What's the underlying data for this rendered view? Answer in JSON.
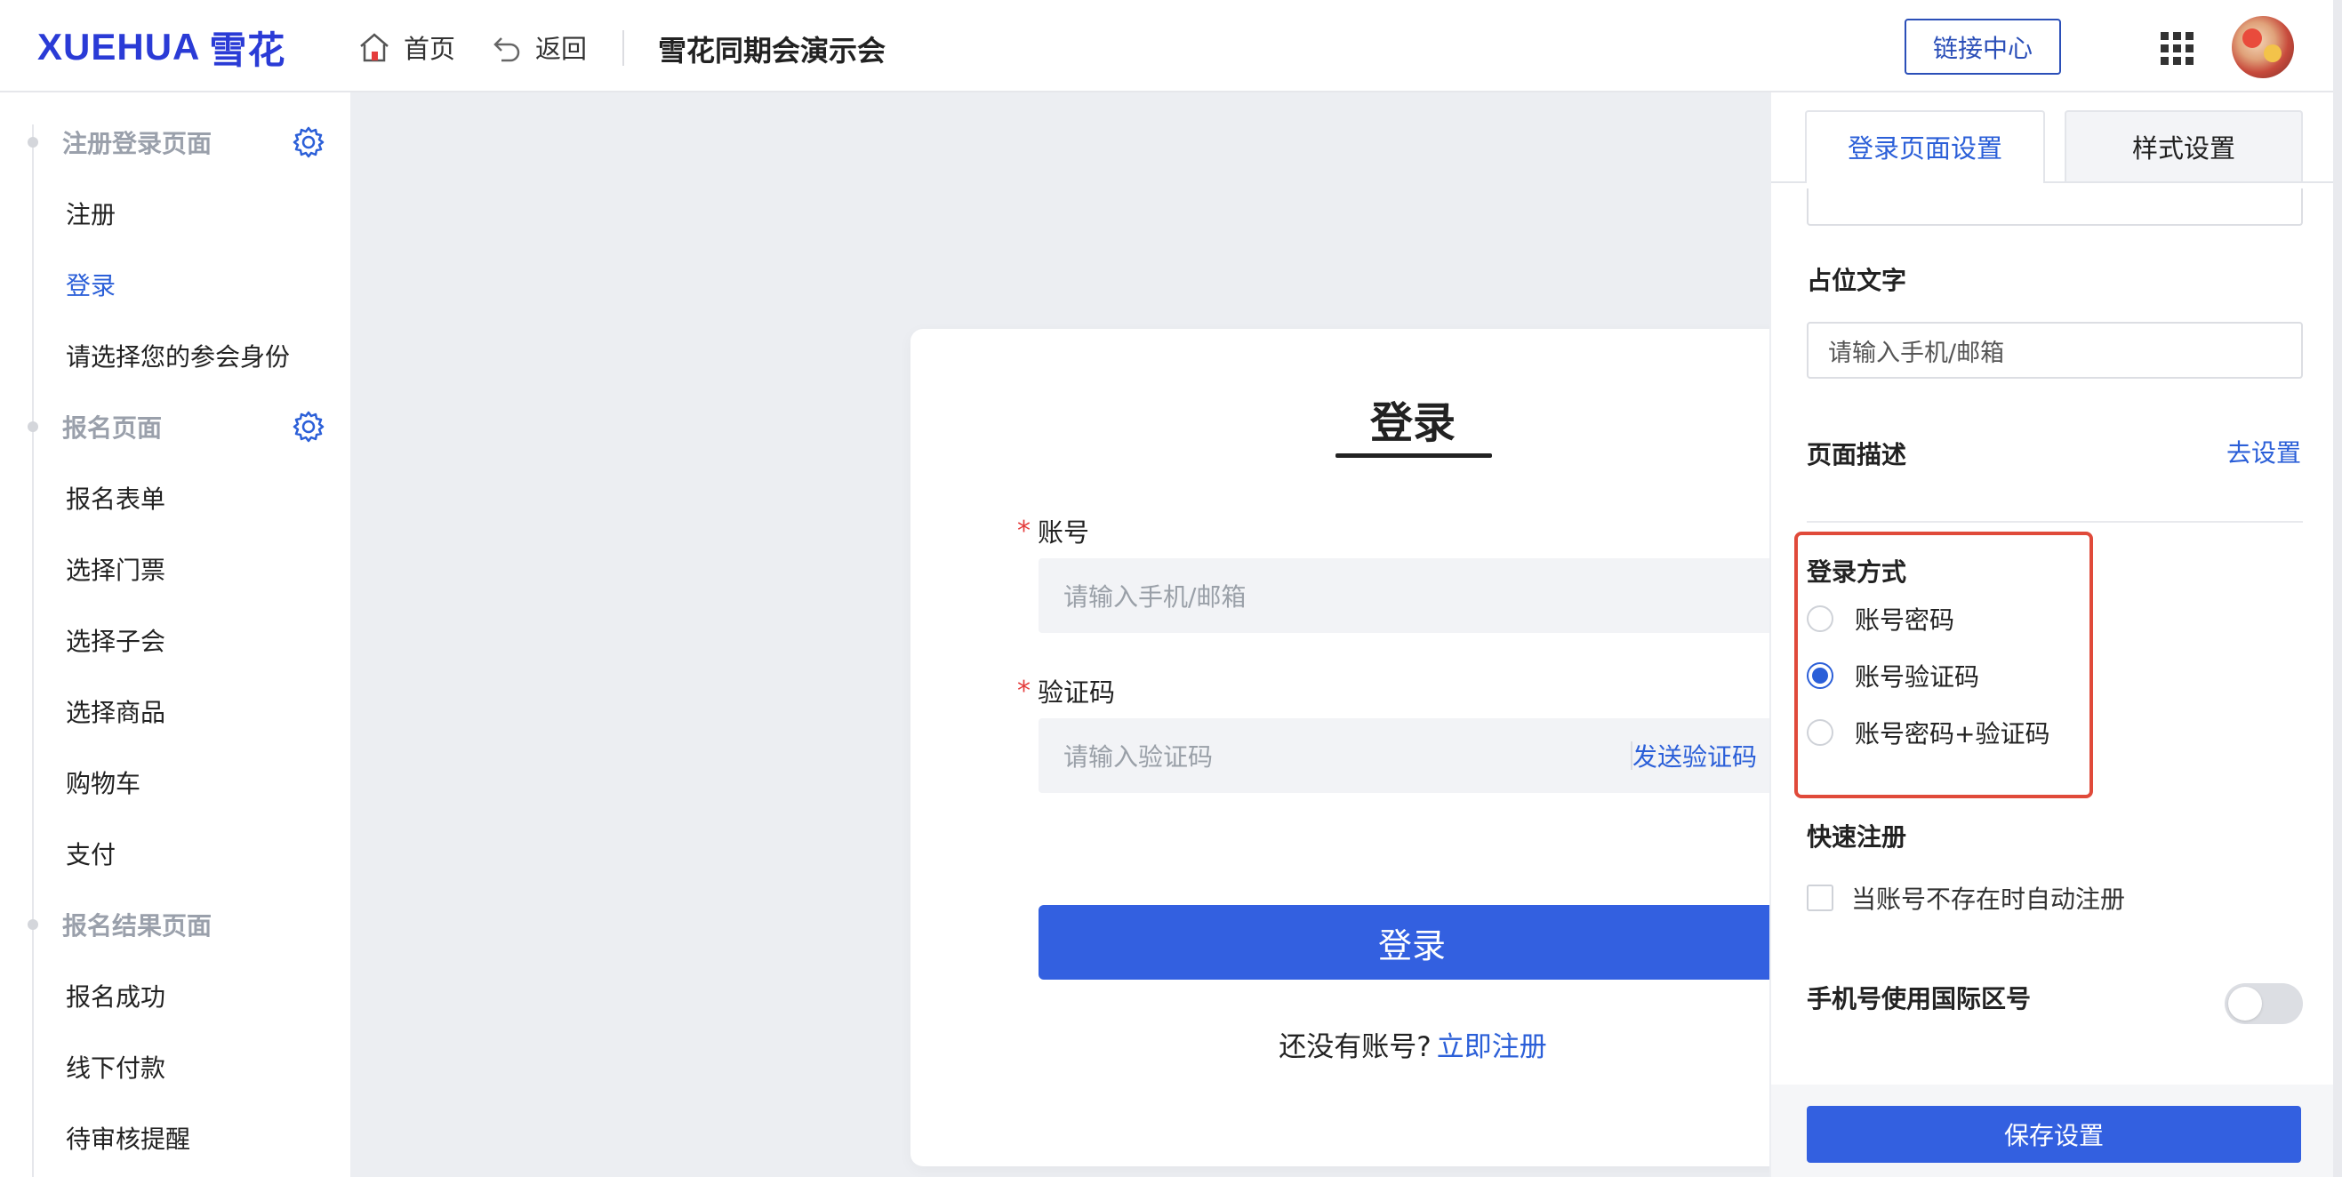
{
  "header": {
    "logo_text": "XUEHUA",
    "logo_cn": "雪花",
    "nav_home": "首页",
    "nav_back": "返回",
    "event_title": "雪花同期会演示会",
    "link_center": "链接中心"
  },
  "sidebar": {
    "sections": [
      {
        "title": "注册登录页面",
        "items": [
          "注册",
          "登录",
          "请选择您的参会身份"
        ]
      },
      {
        "title": "报名页面",
        "items": [
          "报名表单",
          "选择门票",
          "选择子会",
          "选择商品",
          "购物车",
          "支付"
        ]
      },
      {
        "title": "报名结果页面",
        "items": [
          "报名成功",
          "线下付款",
          "待审核提醒"
        ]
      }
    ],
    "active_item": "登录"
  },
  "login_card": {
    "title": "登录",
    "account_label": "账号",
    "account_placeholder": "请输入手机/邮箱",
    "code_label": "验证码",
    "code_placeholder": "请输入验证码",
    "send_code": "发送验证码",
    "login_button": "登录",
    "no_account": "还没有账号?",
    "register_link": "立即注册"
  },
  "settings_panel": {
    "tabs": [
      "登录页面设置",
      "样式设置"
    ],
    "active_tab": 0,
    "placeholder_label": "占位文字",
    "placeholder_value": "请输入手机/邮箱",
    "page_desc_label": "页面描述",
    "page_desc_link": "去设置",
    "login_method_label": "登录方式",
    "login_methods": [
      "账号密码",
      "账号验证码",
      "账号密码+验证码"
    ],
    "login_method_selected": 1,
    "quick_register_label": "快速注册",
    "auto_register": "当账号不存在时自动注册",
    "intl_code_label": "手机号使用国际区号",
    "save_button": "保存设置"
  },
  "colors": {
    "accent": "#3360e0",
    "link": "#2b5fd8",
    "highlight": "#e04a3a",
    "logo": "#2a3bd6"
  }
}
